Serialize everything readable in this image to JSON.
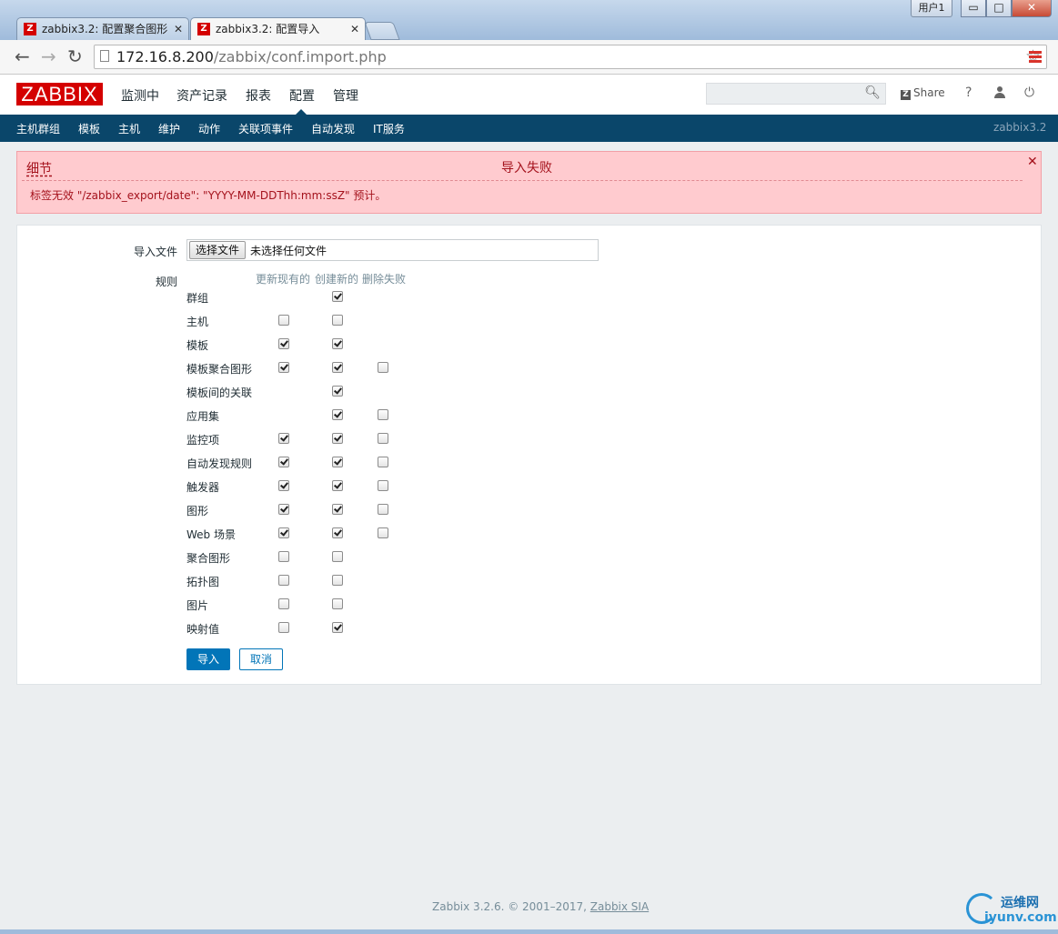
{
  "browser": {
    "tabs": [
      {
        "title": "zabbix3.2: 配置聚合图形",
        "active": false
      },
      {
        "title": "zabbix3.2: 配置导入",
        "active": true
      }
    ],
    "favicon_letter": "Z",
    "user_button": "用户1",
    "window_controls": {
      "minimize": "▭",
      "maximize": "□",
      "close": "✕"
    },
    "url_host": "172.16.8.200",
    "url_path": "/zabbix/conf.import.php"
  },
  "app": {
    "logo": "ZABBIX",
    "main_nav": [
      "监测中",
      "资产记录",
      "报表",
      "配置",
      "管理"
    ],
    "active_nav": "配置",
    "share_label": "Share",
    "share_letter": "Z",
    "help_label": "?",
    "sub_nav": [
      "主机群组",
      "模板",
      "主机",
      "维护",
      "动作",
      "关联项事件",
      "自动发现",
      "IT服务"
    ],
    "server_name": "zabbix3.2"
  },
  "error": {
    "details_label": "细节",
    "title": "导入失败",
    "message": "标签无效 \"/zabbix_export/date\": \"YYYY-MM-DDThh:mm:ssZ\" 预计。"
  },
  "form": {
    "file_label": "导入文件",
    "choose_button": "选择文件",
    "no_file": "未选择任何文件",
    "rules_label": "规则",
    "columns": [
      "更新现有的",
      "创建新的",
      "删除失败"
    ],
    "rules": [
      {
        "name": "群组",
        "update": null,
        "create": true,
        "delete": null
      },
      {
        "name": "主机",
        "update": false,
        "create": false,
        "delete": null
      },
      {
        "name": "模板",
        "update": true,
        "create": true,
        "delete": null
      },
      {
        "name": "模板聚合图形",
        "update": true,
        "create": true,
        "delete": false
      },
      {
        "name": "模板间的关联",
        "update": null,
        "create": true,
        "delete": null
      },
      {
        "name": "应用集",
        "update": null,
        "create": true,
        "delete": false
      },
      {
        "name": "监控项",
        "update": true,
        "create": true,
        "delete": false
      },
      {
        "name": "自动发现规则",
        "update": true,
        "create": true,
        "delete": false
      },
      {
        "name": "触发器",
        "update": true,
        "create": true,
        "delete": false
      },
      {
        "name": "图形",
        "update": true,
        "create": true,
        "delete": false
      },
      {
        "name": "Web 场景",
        "update": true,
        "create": true,
        "delete": false
      },
      {
        "name": "聚合图形",
        "update": false,
        "create": false,
        "delete": null
      },
      {
        "name": "拓扑图",
        "update": false,
        "create": false,
        "delete": null
      },
      {
        "name": "图片",
        "update": false,
        "create": false,
        "delete": null
      },
      {
        "name": "映射值",
        "update": false,
        "create": true,
        "delete": null
      }
    ],
    "import_button": "导入",
    "cancel_button": "取消"
  },
  "footer": {
    "text": "Zabbix 3.2.6. © 2001–2017, ",
    "link": "Zabbix SIA"
  },
  "watermark": {
    "cn": "运维网",
    "en": "iyunv.com"
  }
}
